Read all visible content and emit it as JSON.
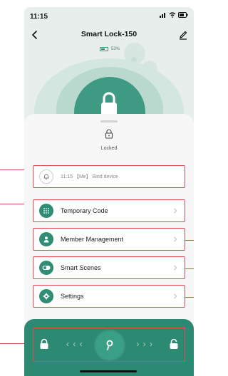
{
  "status_bar": {
    "time": "11:15"
  },
  "nav": {
    "title": "Smart Lock-150"
  },
  "battery": {
    "percent_text": "53%",
    "level": 0.53
  },
  "lock_state": {
    "label": "Locked"
  },
  "recent_log": {
    "text": "11:15 【Me】 Bind device"
  },
  "menu": [
    {
      "label": "Temporary Code",
      "icon": "grid-icon"
    },
    {
      "label": "Member Management",
      "icon": "person-icon"
    },
    {
      "label": "Smart Scenes",
      "icon": "toggle-icon"
    },
    {
      "label": "Settings",
      "icon": "gear-icon"
    }
  ],
  "unlock_slider": {
    "left_arrows": "‹ ‹ ‹",
    "right_arrows": "› › ›"
  },
  "colors": {
    "accent": "#2f8d76",
    "annotation": "#e04a4a",
    "background": "#e8eeec"
  }
}
